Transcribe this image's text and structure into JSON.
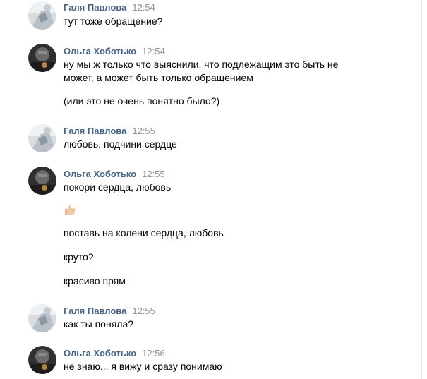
{
  "users": {
    "galya": "Галя Павлова",
    "olga": "Ольга Хоботько"
  },
  "messages": [
    {
      "author": "Галя Павлова",
      "time": "12:54",
      "lines": [
        "тут тоже обращение?"
      ]
    },
    {
      "author": "Ольга Хоботько",
      "time": "12:54",
      "lines": [
        "ну мы ж только что выяснили, что подлежащим это быть не",
        "может, а может быть только обращением",
        "(или это не очень понятно было?)"
      ]
    },
    {
      "author": "Галя Павлова",
      "time": "12:55",
      "lines": [
        "любовь, подчини сердце"
      ]
    },
    {
      "author": "Ольга Хоботько",
      "time": "12:55",
      "lines": [
        "покори сердца, любовь",
        "thumbs-up-emoji",
        "поставь на колени сердца, любовь",
        "круто?",
        "красиво прям"
      ]
    },
    {
      "author": "Галя Павлова",
      "time": "12:55",
      "lines": [
        "как ты поняла?"
      ]
    },
    {
      "author": "Ольга Хоботько",
      "time": "12:56",
      "lines": [
        "не знаю... я вижу и сразу понимаю"
      ]
    }
  ],
  "colors": {
    "author": "#42648b",
    "time": "#939393",
    "text": "#000000"
  }
}
